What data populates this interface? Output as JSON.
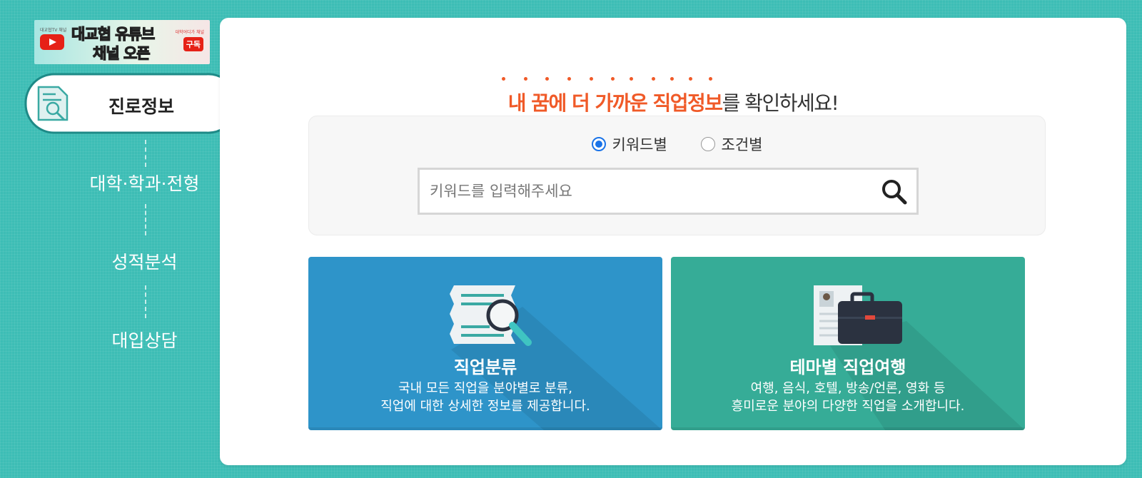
{
  "banner": {
    "small_left": "대교협TV 채널",
    "line1_a": "대교협",
    "line1_b": "유튜브",
    "line2": "채널 오픈",
    "small_right": "대학어디가 채널",
    "subscribe": "구독"
  },
  "sidebar": {
    "active": "진로정보",
    "items": [
      "대학·학과·전형",
      "성적분석",
      "대입상담"
    ]
  },
  "headline": {
    "accent": "내 꿈에 더 가까운 직업정보",
    "rest": "를 확인하세요!"
  },
  "search": {
    "options": [
      "키워드별",
      "조건별"
    ],
    "selected": "키워드별",
    "placeholder": "키워드를 입력해주세요",
    "value": ""
  },
  "cards": [
    {
      "title": "직업분류",
      "desc_line1": "국내 모든 직업을 분야별로 분류,",
      "desc_line2": "직업에 대한 상세한 정보를 제공합니다."
    },
    {
      "title": "테마별 직업여행",
      "desc_line1": "여행, 음식, 호텔, 방송/언론, 영화 등",
      "desc_line2": "흥미로운 분야의 다양한 직업을 소개합니다."
    }
  ],
  "colors": {
    "background": "#3dbdb5",
    "accent": "#f05a28",
    "card_blue": "#2e94c9",
    "card_green": "#36ac97",
    "radio_selected": "#1a73e8"
  }
}
